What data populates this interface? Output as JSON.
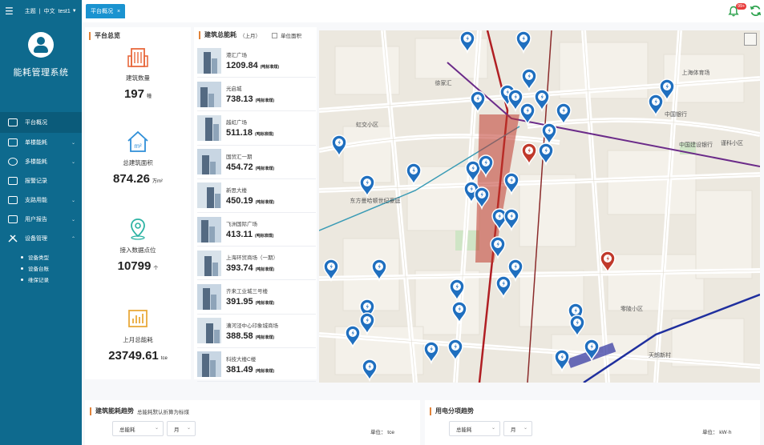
{
  "sidebar": {
    "topic_label": "主题",
    "lang_label": "中文",
    "user": "test1",
    "system_name": "能耗管理系统",
    "menu": [
      {
        "label": "平台概况",
        "icon": "monitor-icon",
        "active": true
      },
      {
        "label": "单楼能耗",
        "icon": "building-icon"
      },
      {
        "label": "多楼能耗",
        "icon": "network-icon"
      },
      {
        "label": "报警记录",
        "icon": "alarm-list-icon"
      },
      {
        "label": "支路用能",
        "icon": "branch-icon"
      },
      {
        "label": "用户报告",
        "icon": "report-icon"
      },
      {
        "label": "设备管理",
        "icon": "tools-icon"
      }
    ],
    "submenu": [
      "设备类型",
      "设备台账",
      "维保记录"
    ]
  },
  "topbar": {
    "tab_label": "平台概况",
    "notification_count": "99+"
  },
  "overview": {
    "title": "平台总览",
    "items": [
      {
        "label": "建筑数量",
        "value": "197",
        "unit": "幢",
        "icon": "building-icon",
        "color": "#e8693d"
      },
      {
        "label": "总建筑面积",
        "value": "874.26",
        "unit": "万m²",
        "icon": "house-area-icon",
        "color": "#2f8fd8"
      },
      {
        "label": "接入数据点位",
        "value": "10799",
        "unit": "个",
        "icon": "location-pin-icon",
        "color": "#2bb3a3"
      },
      {
        "label": "上月总能耗",
        "value": "23749.61",
        "unit": "tce",
        "icon": "bar-chart-icon",
        "color": "#e9a93a"
      }
    ]
  },
  "building_energy": {
    "title": "建筑总能耗",
    "subtitle": "（上月）",
    "unit_checkbox_label": "单位面积",
    "value_unit": "(吨标准煤)",
    "items": [
      {
        "name": "港汇广场",
        "value": "1209.84"
      },
      {
        "name": "光启城",
        "value": "738.13"
      },
      {
        "name": "越虹广场",
        "value": "511.18"
      },
      {
        "name": "国贸汇一期",
        "value": "454.72"
      },
      {
        "name": "新思大楼",
        "value": "450.19"
      },
      {
        "name": "飞洲国际广场",
        "value": "413.11"
      },
      {
        "name": "上海环贸商场（一期）",
        "value": "393.74"
      },
      {
        "name": "齐来工业城三号楼",
        "value": "391.95"
      },
      {
        "name": "漕河泾中心印象城商场",
        "value": "388.58"
      },
      {
        "name": "科技大楼C楼",
        "value": "381.49"
      }
    ]
  },
  "map": {
    "labels": [
      "徐家汇",
      "虹交小区",
      "东方曼哈顿世纪豪庭",
      "零陵小区",
      "中国银行",
      "上海体育场",
      "天朗新村",
      "中国建设银行",
      "谨科小区"
    ],
    "markers_normal_count": 40,
    "markers_alarm_count": 2,
    "marker_color": "#1f6fbf",
    "alarm_color": "#c0392b"
  },
  "trends": {
    "building_trend": {
      "title": "建筑能耗趋势",
      "subtitle": "总能耗默认折算为标煤",
      "select1": "总能耗",
      "select2": "月",
      "unit_label": "单位： tce"
    },
    "electricity_trend": {
      "title": "用电分项趋势",
      "select1": "总能耗",
      "select2": "月",
      "unit_label": "单位： kW·h"
    }
  }
}
